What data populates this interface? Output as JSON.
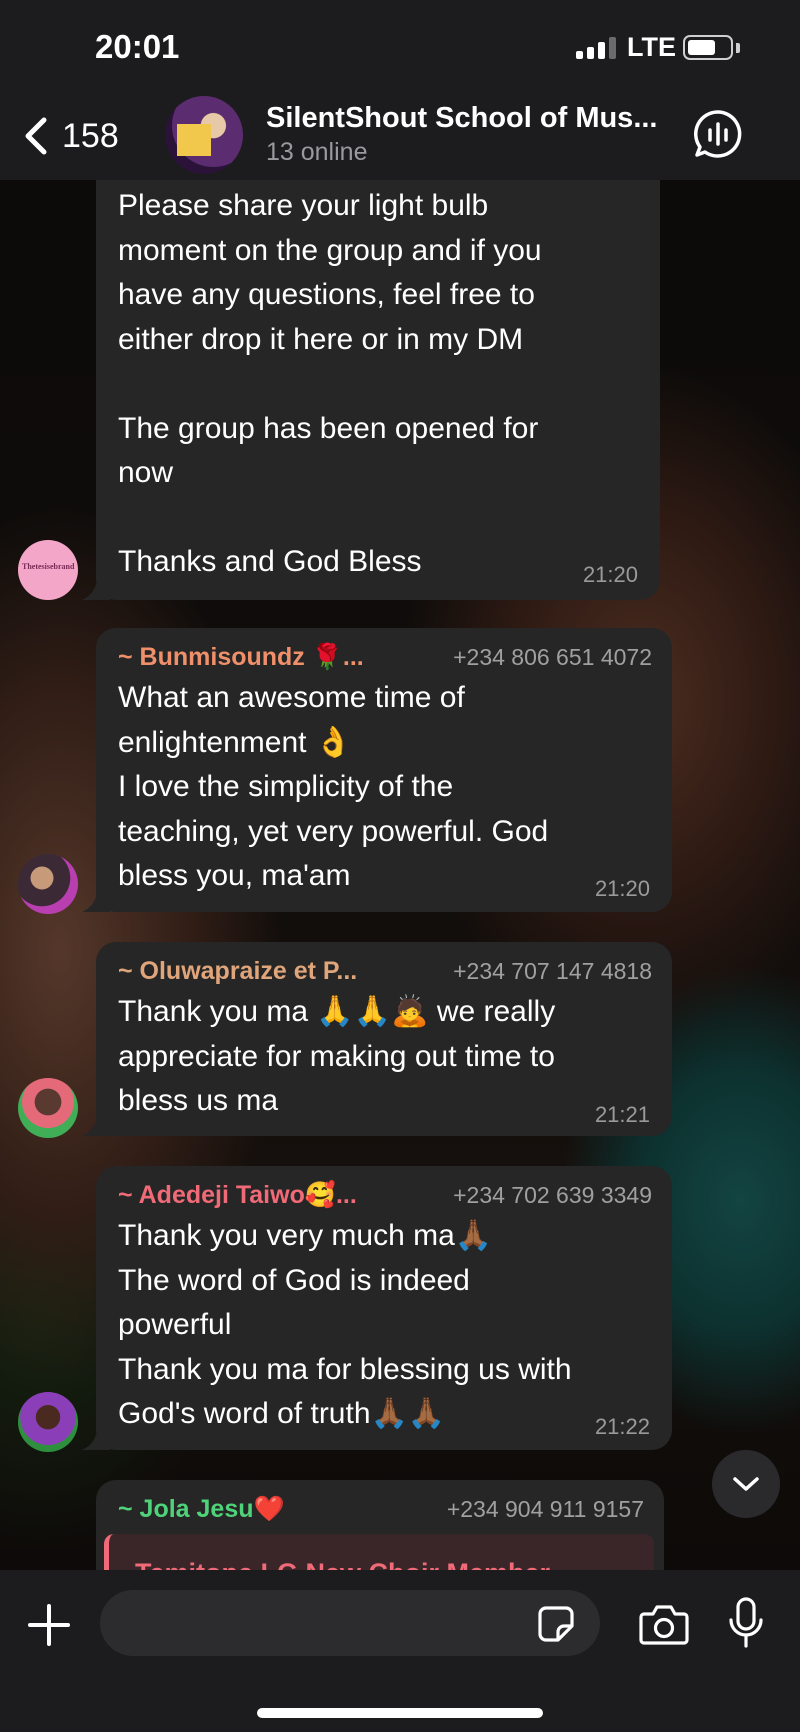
{
  "status_bar": {
    "time": "20:01",
    "network": "LTE"
  },
  "header": {
    "back_count": "158",
    "group_name": "SilentShout School of Mus...",
    "online": "13 online"
  },
  "messages": [
    {
      "sender": "",
      "phone": "",
      "text": "Please share your light bulb\nmoment on the group and if you\nhave any questions, feel free to\neither drop it here or in my DM\n\nThe group has been opened for\nnow\n\nThanks and God Bless",
      "time": "21:20"
    },
    {
      "sender": "~ Bunmisoundz 🌹...",
      "phone": "+234 806 651 4072",
      "name_color": "#f0906a",
      "text": "What an awesome time of\nenlightenment 👌\nI love the simplicity of the\nteaching, yet very powerful.  God\nbless you, ma'am",
      "time": "21:20"
    },
    {
      "sender": "~ Oluwapraize et P...",
      "phone": "+234 707 147 4818",
      "name_color": "#e0a57a",
      "text": "Thank you ma 🙏🙏🙇 we really\nappreciate for making out time to\nbless us ma",
      "time": "21:21"
    },
    {
      "sender": "~ Adedeji Taiwo🥰...",
      "phone": "+234 702 639 3349",
      "name_color": "#f06a78",
      "text": "Thank you very much ma🙏🏾\nThe word of God is indeed\npowerful\nThank you ma for blessing us with\nGod's word of truth🙏🏾🙏🏾",
      "time": "21:22"
    },
    {
      "sender": "~ Jola Jesu❤️",
      "phone": "+234 904 911 9157",
      "name_color": "#4fd37a",
      "quote": "Temitope LG New Choir Member"
    }
  ],
  "avatars": {
    "first": "Thetesisebrand"
  },
  "composer": {
    "placeholder": ""
  },
  "colors": {
    "bubble": "#262626",
    "bar": "#1c1c1e"
  }
}
